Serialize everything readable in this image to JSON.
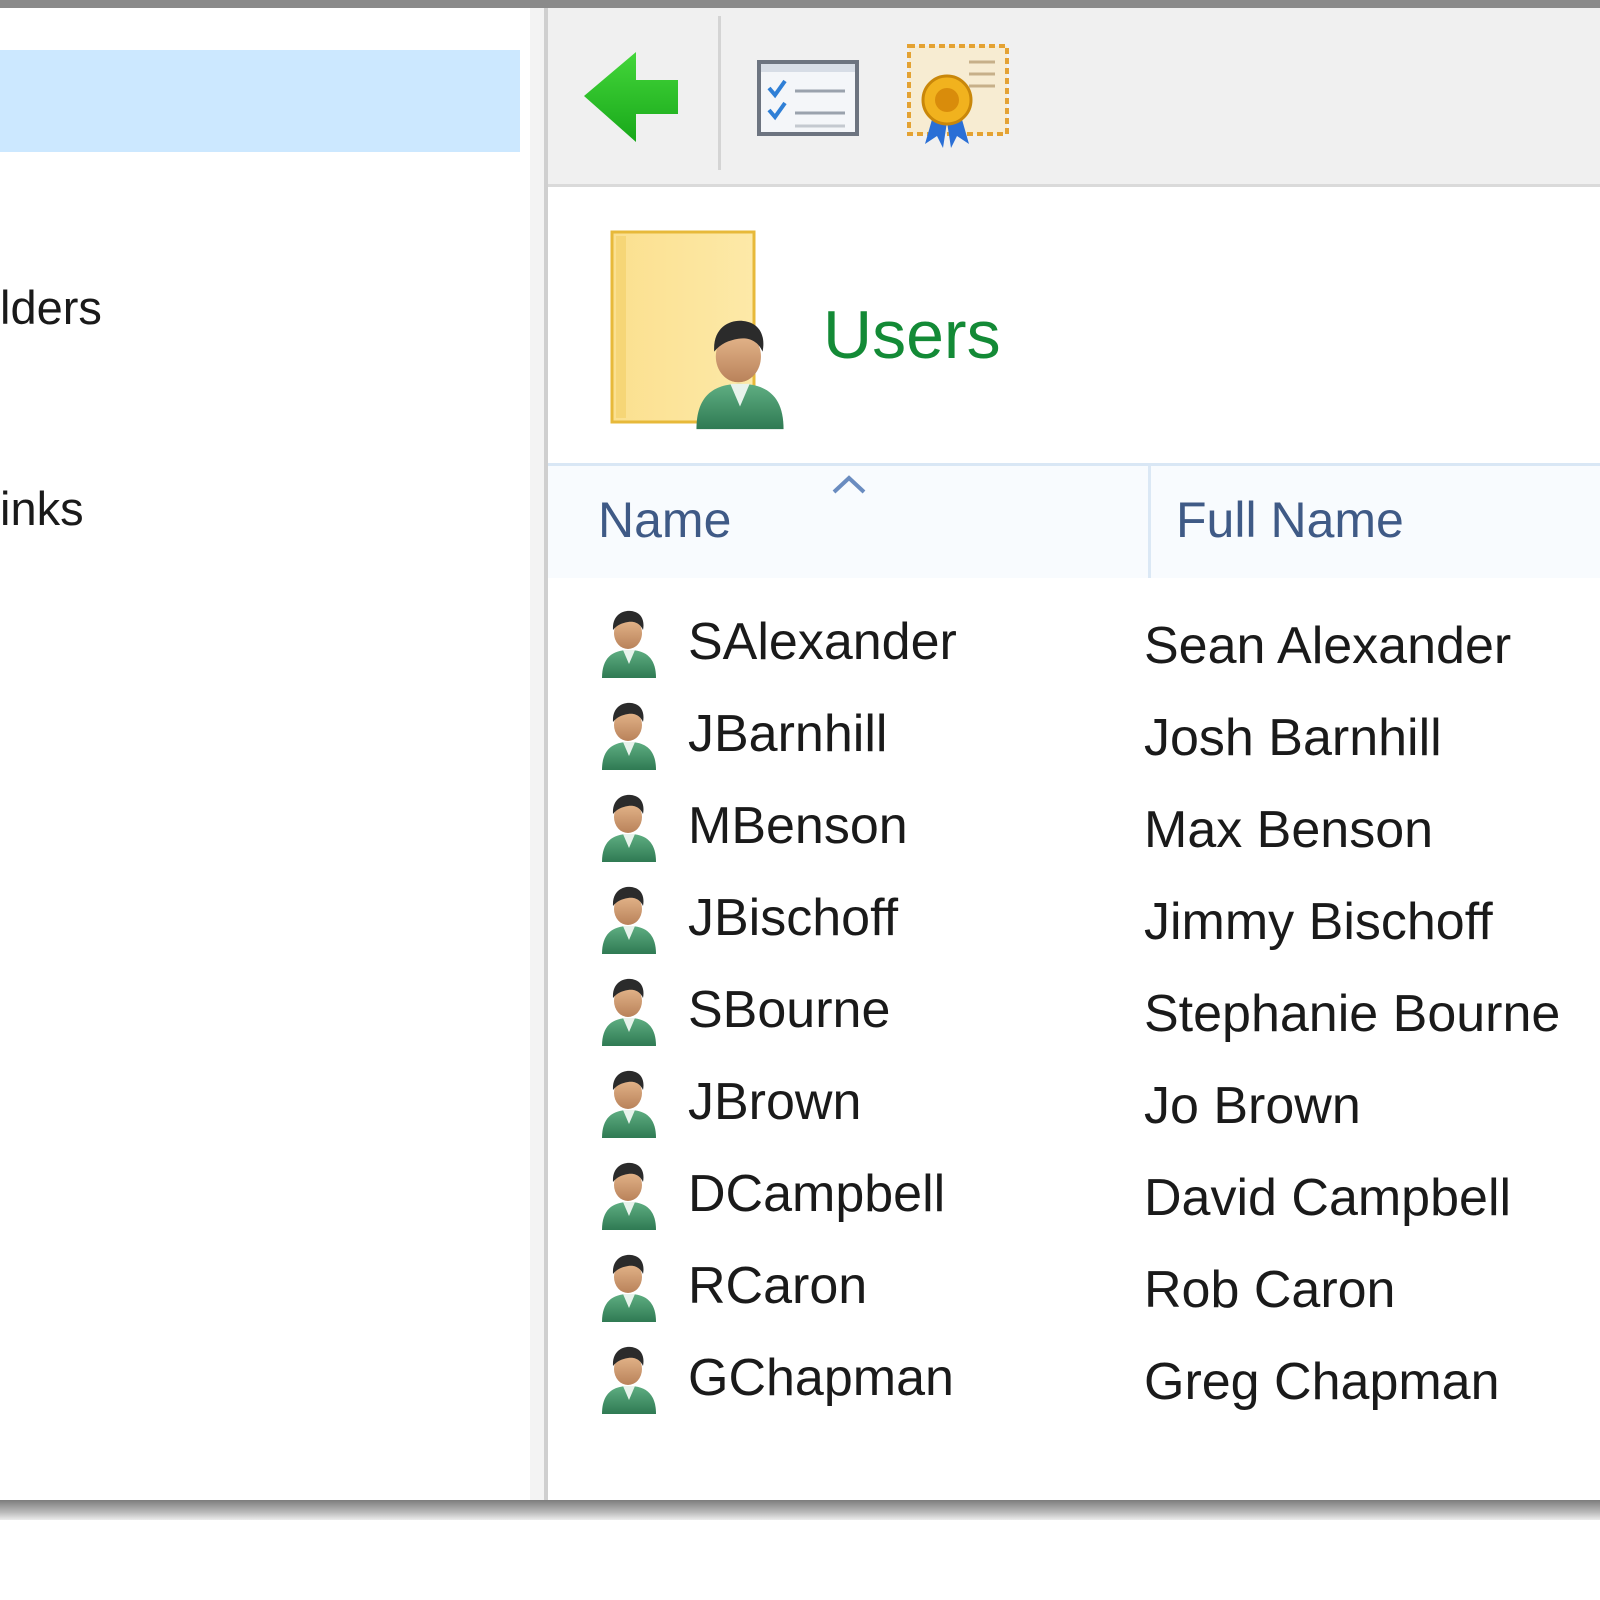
{
  "nav": {
    "items": [
      {
        "label": ""
      },
      {
        "label": "lders"
      },
      {
        "label": "inks"
      }
    ]
  },
  "toolbar": {
    "buttons": [
      {
        "icon": "back-arrow-icon"
      },
      {
        "icon": "properties-checklist-icon"
      },
      {
        "icon": "certificate-icon"
      }
    ]
  },
  "header": {
    "title": "Users",
    "icon": "users-folder-icon"
  },
  "table": {
    "columns": [
      "Name",
      "Full Name"
    ],
    "sort": {
      "column": "Name",
      "direction": "ascending"
    },
    "rows": [
      {
        "name": "SAlexander",
        "full_name": "Sean Alexander"
      },
      {
        "name": "JBarnhill",
        "full_name": "Josh Barnhill"
      },
      {
        "name": "MBenson",
        "full_name": "Max Benson"
      },
      {
        "name": "JBischoff",
        "full_name": "Jimmy Bischoff"
      },
      {
        "name": "SBourne",
        "full_name": "Stephanie Bourne"
      },
      {
        "name": "JBrown",
        "full_name": "Jo Brown"
      },
      {
        "name": "DCampbell",
        "full_name": "David Campbell"
      },
      {
        "name": "RCaron",
        "full_name": "Rob Caron"
      },
      {
        "name": "GChapman",
        "full_name": "Greg Chapman"
      }
    ]
  },
  "colors": {
    "selection": "#cce8ff",
    "title": "#138a36",
    "column_header_text": "#3f5a86"
  }
}
